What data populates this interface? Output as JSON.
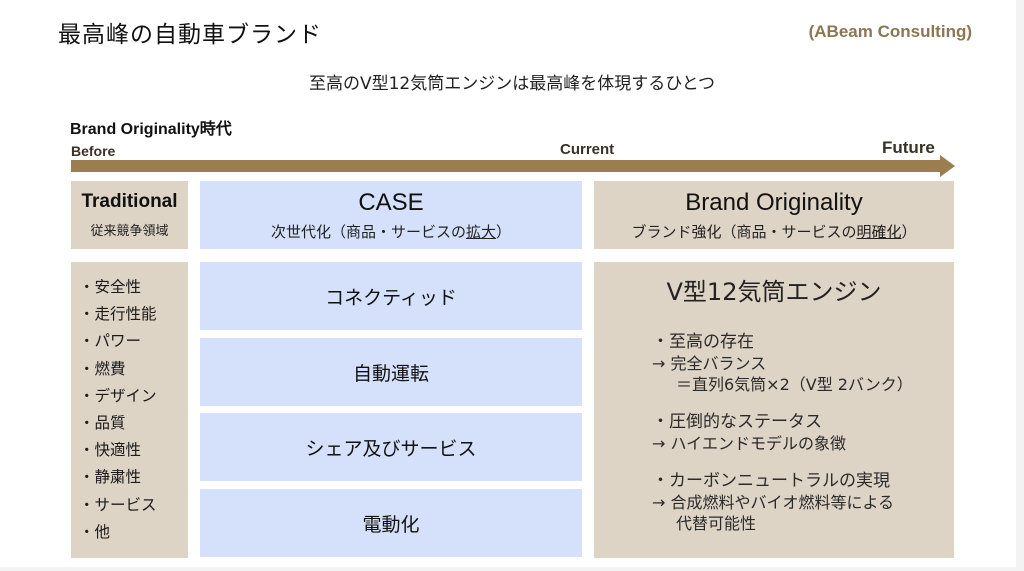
{
  "header": {
    "title": "最高峰の自動車ブランド",
    "source": "(ABeam Consulting)",
    "subtitle": "至高のV型12気筒エンジンは最高峰を体現するひとつ"
  },
  "timeline": {
    "era_label": "Brand Originality時代",
    "before": "Before",
    "current": "Current",
    "future": "Future",
    "arrow_color": "#9a7e4f"
  },
  "columns": {
    "traditional": {
      "title": "Traditional",
      "subtitle": "従来競争領域",
      "items": [
        "・安全性",
        "・走行性能",
        "・パワー",
        "・燃費",
        "・デザイン",
        "・品質",
        "・快適性",
        "・静粛性",
        "・サービス",
        "・他"
      ]
    },
    "case": {
      "title": "CASE",
      "subtitle_prefix": "次世代化（商品・サービスの",
      "subtitle_underlined": "拡大",
      "subtitle_suffix": "）",
      "items": [
        "コネクティッド",
        "自動運転",
        "シェア及びサービス",
        "電動化"
      ]
    },
    "brand": {
      "title": "Brand Originality",
      "subtitle_prefix": "ブランド強化（商品・サービスの",
      "subtitle_underlined": "明確化",
      "subtitle_suffix": "）",
      "heading": "V型12気筒エンジン",
      "points": [
        {
          "head": "・至高の存在",
          "lines": [
            "→ 完全バランス",
            "＝直列6気筒×2（V型 2バンク）"
          ]
        },
        {
          "head": "・圧倒的なステータス",
          "lines": [
            "→ ハイエンドモデルの象徴"
          ]
        },
        {
          "head": "・カーボンニュートラルの実現",
          "lines": [
            "→ 合成燃料やバイオ燃料等による",
            "代替可能性"
          ]
        }
      ]
    }
  },
  "colors": {
    "tan": "#ddd4c6",
    "blue": "#d5e0fa",
    "accent": "#8a7754"
  }
}
